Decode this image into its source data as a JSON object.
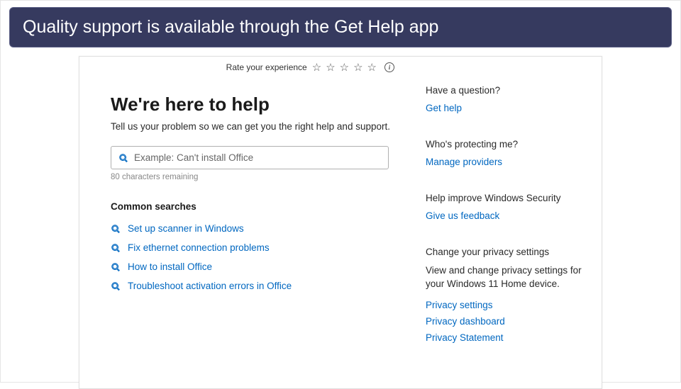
{
  "banner": {
    "text": "Quality support is available through the Get Help app"
  },
  "rating": {
    "label": "Rate your experience"
  },
  "main": {
    "heading": "We're here to help",
    "subtitle": "Tell us your problem so we can get you the right help and support.",
    "search_placeholder": "Example: Can't install Office",
    "counter": "80 characters remaining",
    "common_heading": "Common searches",
    "searches": [
      "Set up scanner in Windows",
      "Fix ethernet connection problems",
      "How to install Office",
      "Troubleshoot activation errors in Office"
    ]
  },
  "sidebar": {
    "question": {
      "title": "Have a question?",
      "link": "Get help"
    },
    "protect": {
      "title": "Who's protecting me?",
      "link": "Manage providers"
    },
    "improve": {
      "title": "Help improve Windows Security",
      "link": "Give us feedback"
    },
    "privacy": {
      "title": "Change your privacy settings",
      "desc": "View and change privacy settings for your Windows 11 Home device.",
      "links": [
        "Privacy settings",
        "Privacy dashboard",
        "Privacy Statement"
      ]
    }
  }
}
